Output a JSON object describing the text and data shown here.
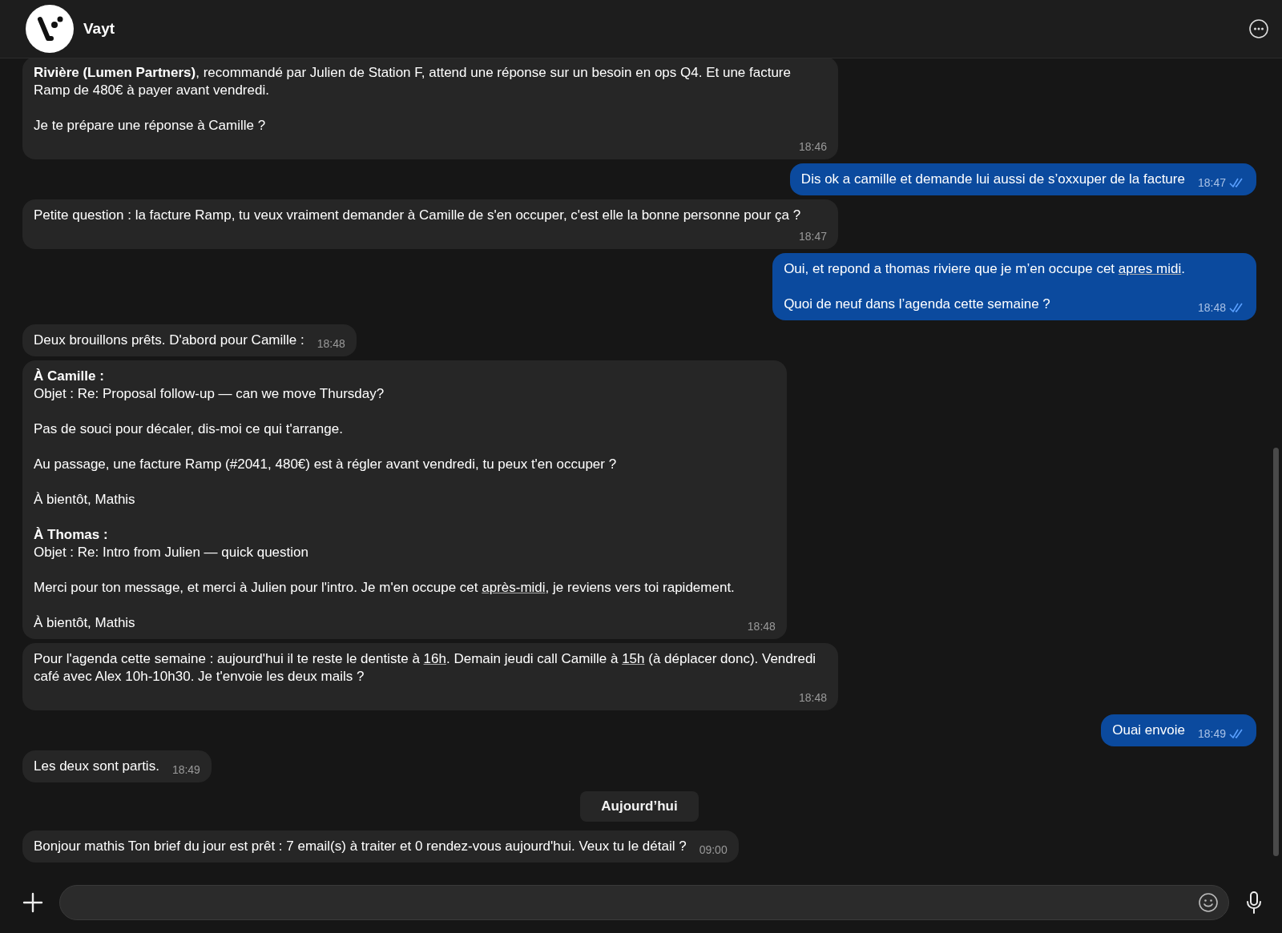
{
  "header": {
    "name": "Vayt"
  },
  "messages": [
    {
      "kind": "bot",
      "paragraphs": [
        "**Rivière (Lumen Partners)**, recommandé par Julien de Station F, attend une réponse sur un besoin en ops Q4. Et une facture Ramp de 480€ à payer avant vendredi.",
        "Je te prépare une réponse à Camille ?"
      ],
      "time": "18:46"
    },
    {
      "kind": "user",
      "paragraphs": [
        "Dis ok a camille et demande lui aussi de s’oxxuper de la facture"
      ],
      "time": "18:47",
      "read": true
    },
    {
      "kind": "bot",
      "paragraphs": [
        "Petite question : la facture Ramp, tu veux vraiment demander à Camille de s'en occuper, c'est elle la bonne personne pour ça ?"
      ],
      "time": "18:47"
    },
    {
      "kind": "user",
      "paragraphs": [
        [
          "Oui, et repond a thomas riviere que je m’en occupe cet ",
          {
            "link": "apres midi"
          },
          "."
        ],
        "Quoi de neuf dans l’agenda cette semaine ?"
      ],
      "time": "18:48",
      "read": true
    },
    {
      "kind": "bot",
      "paragraphs": [
        "Deux brouillons prêts. D'abord pour Camille :"
      ],
      "time": "18:48"
    },
    {
      "kind": "bot",
      "paragraphs": [
        "**À Camille :**\nObjet : Re: Proposal follow-up — can we move Thursday?",
        "Pas de souci pour décaler, dis-moi ce qui t'arrange.",
        "Au passage, une facture Ramp (#2041, 480€) est à régler avant vendredi, tu peux t'en occuper ?",
        "À bientôt, Mathis",
        "**À Thomas :**\nObjet : Re: Intro from Julien — quick question",
        [
          "Merci pour ton message, et merci à Julien pour l'intro. Je m'en occupe cet ",
          {
            "link": "après-midi"
          },
          ", je reviens vers toi rapidement."
        ],
        "À bientôt, Mathis"
      ],
      "time": "18:48"
    },
    {
      "kind": "bot",
      "paragraphs": [
        [
          "Pour l'agenda cette semaine : aujourd'hui il te reste le dentiste à ",
          {
            "link": "16h"
          },
          ". Demain jeudi call Camille à ",
          {
            "link": "15h"
          },
          " (à déplacer donc). Vendredi café avec Alex 10h-10h30. Je t'envoie les deux mails ?"
        ]
      ],
      "time": "18:48"
    },
    {
      "kind": "user",
      "paragraphs": [
        "Ouai envoie"
      ],
      "time": "18:49",
      "read": true
    },
    {
      "kind": "bot",
      "paragraphs": [
        "Les deux sont partis."
      ],
      "time": "18:49"
    },
    {
      "kind": "divider",
      "label": "Aujourd’hui"
    },
    {
      "kind": "bot",
      "paragraphs": [
        "Bonjour mathis Ton brief du jour est prêt : 7 email(s) à traiter et 0 rendez-vous aujourd'hui. Veux tu le détail ?"
      ],
      "time": "09:00"
    }
  ]
}
